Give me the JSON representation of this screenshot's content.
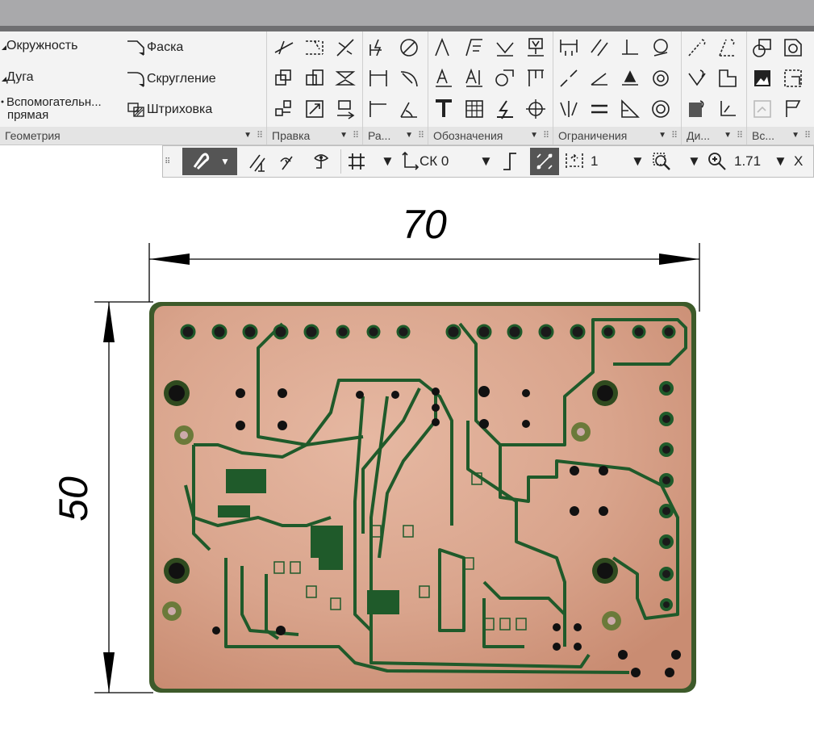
{
  "ribbon": {
    "geometry": {
      "title": "Геометрия",
      "commands": [
        "Окружность",
        "Фаска",
        "Дуга",
        "Скругление",
        "Вспомогательн...",
        "прямая",
        "Штриховка"
      ]
    },
    "groups": [
      "Правка",
      "Ра...",
      "Обозначения",
      "Ограничения",
      "Ди...",
      "Вс..."
    ]
  },
  "toolbar": {
    "cs_value": "СК 0",
    "step_value": "1",
    "zoom_value": "1.71",
    "x_label": "X"
  },
  "drawing": {
    "dim_width": "70",
    "dim_height": "50"
  },
  "colors": {
    "board_copper": "#d9a48c",
    "trace_green": "#1f5a2a",
    "dimension_line": "#000000"
  }
}
